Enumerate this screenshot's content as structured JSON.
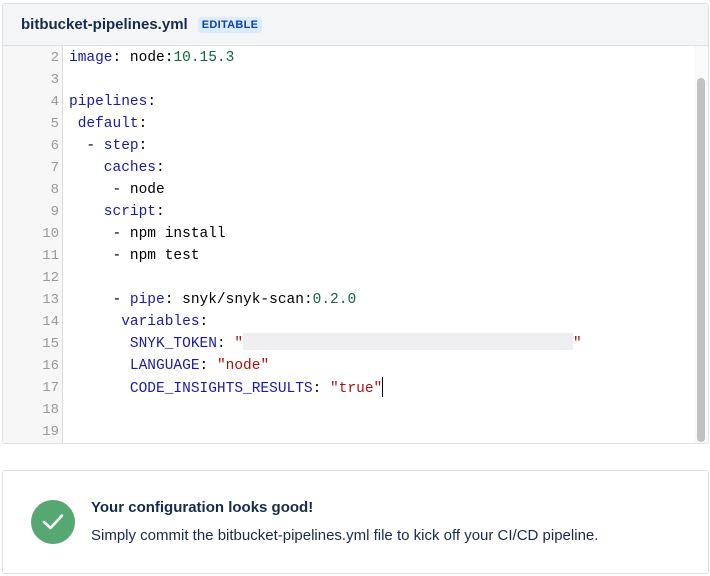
{
  "editor": {
    "file_name": "bitbucket-pipelines.yml",
    "badge": "EDITABLE",
    "lines": [
      {
        "n": "2",
        "indent": 0,
        "tokens": [
          {
            "t": "image",
            "c": "key"
          },
          {
            "t": ": ",
            "c": "plain"
          },
          {
            "t": "node:",
            "c": "plain"
          },
          {
            "t": "10.15.3",
            "c": "num"
          }
        ]
      },
      {
        "n": "3",
        "indent": 0,
        "tokens": []
      },
      {
        "n": "4",
        "indent": 0,
        "tokens": [
          {
            "t": "pipelines",
            "c": "key"
          },
          {
            "t": ":",
            "c": "plain"
          }
        ]
      },
      {
        "n": "5",
        "indent": 1,
        "tokens": [
          {
            "t": "default",
            "c": "key"
          },
          {
            "t": ":",
            "c": "plain"
          }
        ]
      },
      {
        "n": "6",
        "indent": 2,
        "tokens": [
          {
            "t": "- ",
            "c": "plain"
          },
          {
            "t": "step",
            "c": "key"
          },
          {
            "t": ":",
            "c": "plain"
          }
        ]
      },
      {
        "n": "7",
        "indent": 4,
        "tokens": [
          {
            "t": "caches",
            "c": "key"
          },
          {
            "t": ":",
            "c": "plain"
          }
        ]
      },
      {
        "n": "8",
        "indent": 5,
        "tokens": [
          {
            "t": "- node",
            "c": "plain"
          }
        ]
      },
      {
        "n": "9",
        "indent": 4,
        "tokens": [
          {
            "t": "script",
            "c": "key"
          },
          {
            "t": ":",
            "c": "plain"
          }
        ]
      },
      {
        "n": "10",
        "indent": 5,
        "tokens": [
          {
            "t": "- npm install",
            "c": "plain"
          }
        ]
      },
      {
        "n": "11",
        "indent": 5,
        "tokens": [
          {
            "t": "- npm test",
            "c": "plain"
          }
        ]
      },
      {
        "n": "12",
        "indent": 0,
        "tokens": []
      },
      {
        "n": "13",
        "indent": 5,
        "tokens": [
          {
            "t": "- ",
            "c": "plain"
          },
          {
            "t": "pipe",
            "c": "key"
          },
          {
            "t": ": snyk/snyk-scan:",
            "c": "plain"
          },
          {
            "t": "0.2.0",
            "c": "num"
          }
        ]
      },
      {
        "n": "14",
        "indent": 6,
        "tokens": [
          {
            "t": "variables",
            "c": "key"
          },
          {
            "t": ":",
            "c": "plain"
          }
        ]
      },
      {
        "n": "15",
        "indent": 7,
        "tokens": [
          {
            "t": "SNYK_TOKEN",
            "c": "key"
          },
          {
            "t": ": ",
            "c": "plain"
          },
          {
            "t": "\"",
            "c": "str"
          },
          {
            "t": "",
            "c": "redacted"
          },
          {
            "t": "\"",
            "c": "str"
          }
        ]
      },
      {
        "n": "16",
        "indent": 7,
        "tokens": [
          {
            "t": "LANGUAGE",
            "c": "key"
          },
          {
            "t": ": ",
            "c": "plain"
          },
          {
            "t": "\"node\"",
            "c": "str"
          }
        ]
      },
      {
        "n": "17",
        "indent": 7,
        "tokens": [
          {
            "t": "CODE_INSIGHTS_RESULTS",
            "c": "key"
          },
          {
            "t": ": ",
            "c": "plain"
          },
          {
            "t": "\"true\"",
            "c": "str"
          },
          {
            "t": "",
            "c": "caret"
          }
        ]
      },
      {
        "n": "18",
        "indent": 0,
        "tokens": []
      },
      {
        "n": "19",
        "indent": 0,
        "tokens": []
      }
    ]
  },
  "status": {
    "icon": "check-icon",
    "title": "Your configuration looks good!",
    "message": "Simply commit the bitbucket-pipelines.yml file to kick off your CI/CD pipeline.",
    "color": "#57a773"
  }
}
